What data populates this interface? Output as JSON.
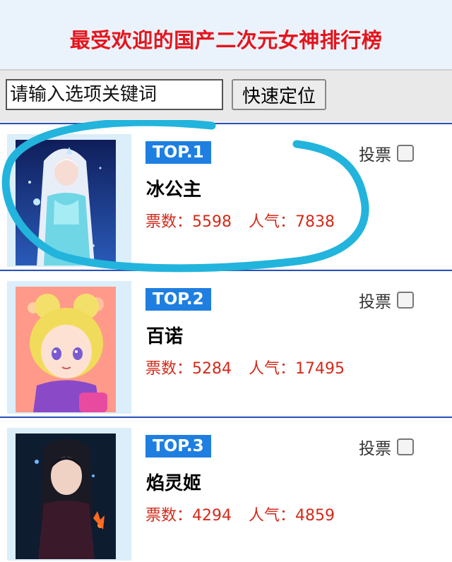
{
  "page": {
    "title": "最受欢迎的国产二次元女神排行榜"
  },
  "search": {
    "placeholder": "请输入选项关键词",
    "button_label": "快速定位"
  },
  "entries": [
    {
      "rank": "TOP.1",
      "name": "冰公主",
      "votes_label": "票数：",
      "votes": "5598",
      "popularity_label": "人气：",
      "popularity": "7838",
      "vote_label": "投票"
    },
    {
      "rank": "TOP.2",
      "name": "百诺",
      "votes_label": "票数：",
      "votes": "5284",
      "popularity_label": "人气：",
      "popularity": "17495",
      "vote_label": "投票"
    },
    {
      "rank": "TOP.3",
      "name": "焰灵姬",
      "votes_label": "票数：",
      "votes": "4294",
      "popularity_label": "人气：",
      "popularity": "4859",
      "vote_label": "投票"
    }
  ],
  "colors": {
    "title": "#e6141c",
    "rank_badge": "#1e7fe0",
    "stats": "#d42a1a",
    "highlight_stroke": "#22b4dc"
  }
}
